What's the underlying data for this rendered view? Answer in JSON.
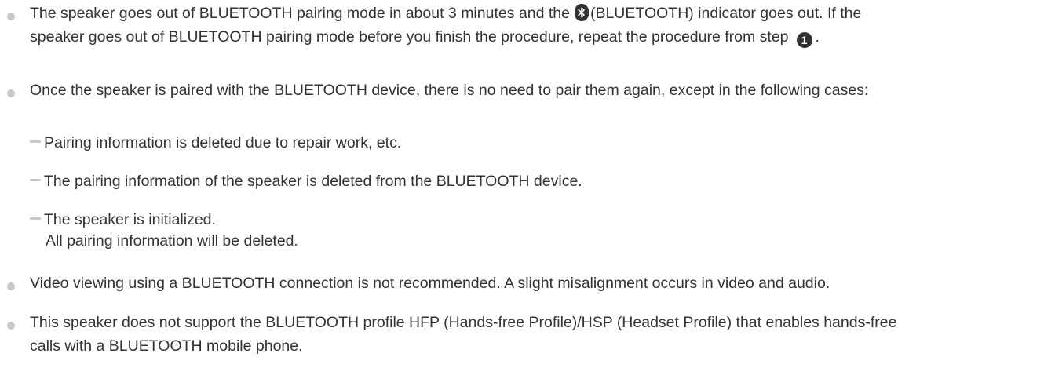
{
  "notes": [
    {
      "line1_a": "The speaker goes out of BLUETOOTH pairing mode in about 3 minutes and the",
      "line1_b": "(BLUETOOTH) indicator goes out. If the",
      "line2_a": "speaker goes out of BLUETOOTH pairing mode before you finish the procedure, repeat the procedure from step",
      "step_number": "1",
      "line2_b": "."
    },
    {
      "text": "Once the speaker is paired with the BLUETOOTH device, there is no need to pair them again, except in the following cases:",
      "cases": [
        "Pairing information is deleted due to repair work, etc.",
        "The pairing information of the speaker is deleted from the BLUETOOTH device.",
        "The speaker is initialized."
      ],
      "case3_detail": "All pairing information will be deleted."
    },
    {
      "text": "Video viewing using a BLUETOOTH connection is not recommended. A slight misalignment occurs in video and audio."
    },
    {
      "line1": "This speaker does not support the BLUETOOTH profile HFP (Hands-free Profile)/HSP (Headset Profile) that enables hands-free",
      "line2": "calls with a BLUETOOTH mobile phone."
    }
  ],
  "icons": {
    "bluetooth": "bluetooth-icon",
    "step": "step-number-icon",
    "bullet": "bullet-icon",
    "dash": "dash-icon"
  },
  "colors": {
    "text": "#333333",
    "bullet": "#c8c8c8"
  }
}
